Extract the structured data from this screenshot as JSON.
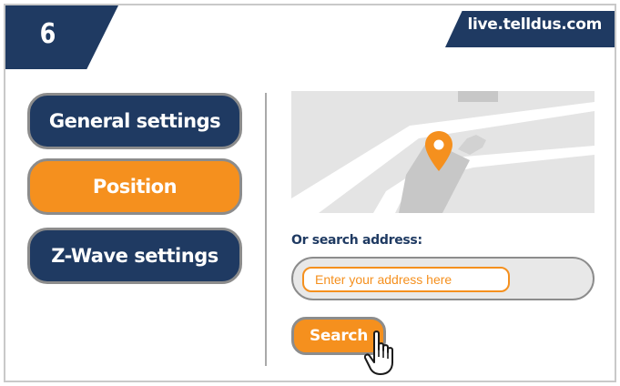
{
  "step": {
    "number": "6"
  },
  "header": {
    "url": "live.telldus.com"
  },
  "menu": {
    "items": [
      {
        "label": "General settings",
        "active": false
      },
      {
        "label": "Position",
        "active": true
      },
      {
        "label": "Z-Wave settings",
        "active": false
      }
    ]
  },
  "position": {
    "search_label": "Or search address:",
    "input_placeholder": "Enter your address here",
    "input_value": "",
    "search_button": "Search"
  },
  "icons": {
    "map_pin": "map-pin-icon",
    "cursor": "hand-pointer-icon"
  },
  "colors": {
    "navy": "#1f3a62",
    "orange": "#f5901e",
    "border_gray": "#8c8c8c",
    "map_bg": "#e4e4e4"
  }
}
